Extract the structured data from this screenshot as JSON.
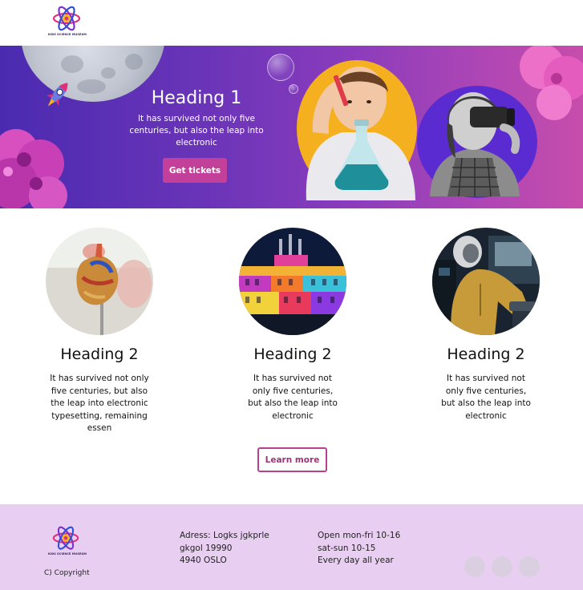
{
  "header": {
    "logo_text": "KIDS SCIENCE MUSEUM"
  },
  "hero": {
    "title": "Heading 1",
    "text": "It has survived not only five centuries, but also the leap into electronic",
    "button_label": "Get tickets"
  },
  "features": [
    {
      "title": "Heading 2",
      "text": "It has survived not only five centuries, but also the leap into electronic typesetting, remaining essen"
    },
    {
      "title": "Heading 2",
      "text": "It has survived not only five centuries, but also the leap into electronic"
    },
    {
      "title": "Heading 2",
      "text": "It has survived not only five centuries, but also the leap into electronic"
    }
  ],
  "learn_more_label": "Learn more",
  "footer": {
    "logo_text": "KIDS SCIENCE MUSEUM",
    "copyright": "C) Copyright",
    "address": [
      "Adress: Logks jgkprle",
      "gkgol 19990",
      "4940 OSLO"
    ],
    "hours": [
      "Open mon-fri 10-16",
      "sat-sun 10-15",
      "Every day all year"
    ],
    "social_icons": [
      "social-icon",
      "social-icon",
      "social-icon"
    ]
  },
  "colors": {
    "accent": "#c23f9a",
    "footer_bg": "#e8cff2",
    "hero_start": "#4a2bb0",
    "hero_end": "#c64dab"
  }
}
